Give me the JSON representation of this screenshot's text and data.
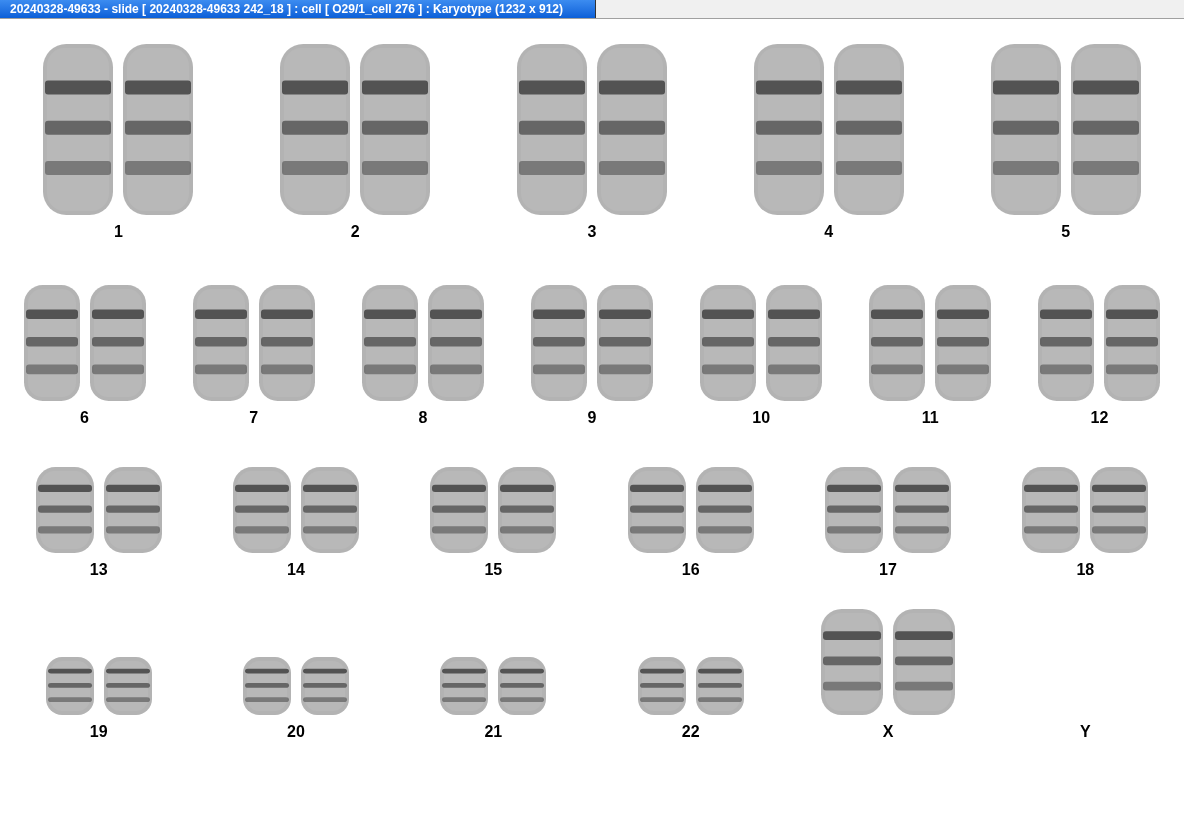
{
  "window": {
    "title": "20240328-49633 - slide [ 20240328-49633 242_18 ] : cell [ O29/1_cell 276 ] : Karyotype  (1232 x 912)"
  },
  "rows": [
    {
      "pairs": [
        {
          "label": "1",
          "present": true
        },
        {
          "label": "2",
          "present": true
        },
        {
          "label": "3",
          "present": true
        },
        {
          "label": "4",
          "present": true
        },
        {
          "label": "5",
          "present": true
        }
      ]
    },
    {
      "pairs": [
        {
          "label": "6",
          "present": true
        },
        {
          "label": "7",
          "present": true
        },
        {
          "label": "8",
          "present": true
        },
        {
          "label": "9",
          "present": true
        },
        {
          "label": "10",
          "present": true
        },
        {
          "label": "11",
          "present": true
        },
        {
          "label": "12",
          "present": true
        }
      ]
    },
    {
      "pairs": [
        {
          "label": "13",
          "present": true
        },
        {
          "label": "14",
          "present": true
        },
        {
          "label": "15",
          "present": true
        },
        {
          "label": "16",
          "present": true
        },
        {
          "label": "17",
          "present": true
        },
        {
          "label": "18",
          "present": true
        }
      ]
    },
    {
      "pairs": [
        {
          "label": "19",
          "present": true
        },
        {
          "label": "20",
          "present": true
        },
        {
          "label": "21",
          "present": true
        },
        {
          "label": "22",
          "present": true
        },
        {
          "label": "X",
          "present": true
        },
        {
          "label": "Y",
          "present": false
        }
      ]
    }
  ]
}
